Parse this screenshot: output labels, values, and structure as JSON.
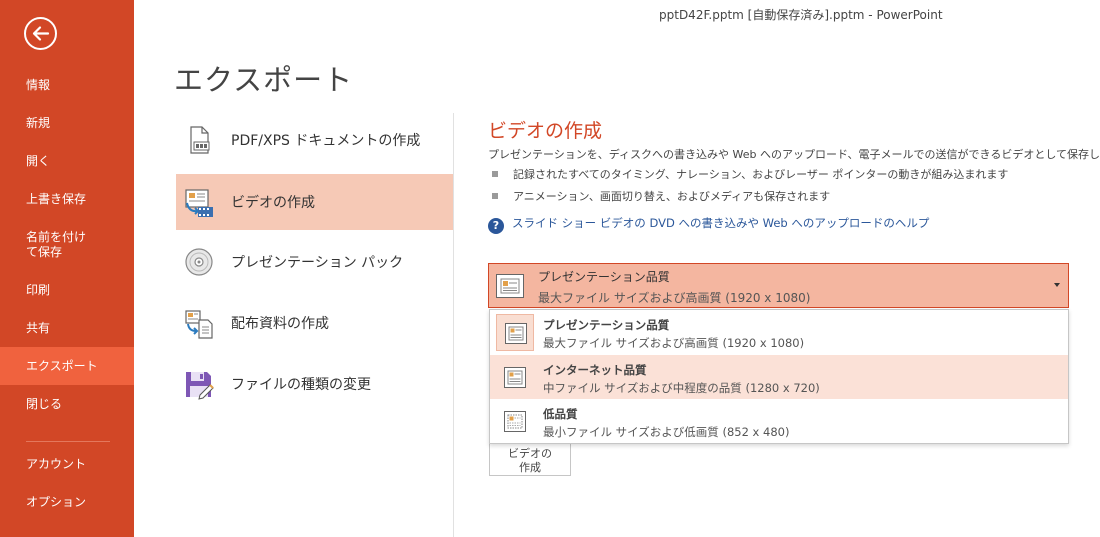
{
  "window": {
    "title": "pptD42F.pptm [自動保存済み].pptm - PowerPoint"
  },
  "sidebar": {
    "back_icon": "back-arrow-icon",
    "items": [
      {
        "label": "情報"
      },
      {
        "label": "新規"
      },
      {
        "label": "開く"
      },
      {
        "label": "上書き保存"
      },
      {
        "label": "名前を付けて保存"
      },
      {
        "label": "印刷"
      },
      {
        "label": "共有"
      },
      {
        "label": "エクスポート",
        "active": true
      },
      {
        "label": "閉じる"
      },
      {
        "label": "アカウント"
      },
      {
        "label": "オプション"
      }
    ]
  },
  "page": {
    "title": "エクスポート"
  },
  "export_options": [
    {
      "label": "PDF/XPS ドキュメントの作成",
      "icon": "pdf-document-icon"
    },
    {
      "label": "ビデオの作成",
      "icon": "video-icon",
      "selected": true
    },
    {
      "label": "プレゼンテーション パック",
      "icon": "cd-package-icon"
    },
    {
      "label": "配布資料の作成",
      "icon": "handout-icon"
    },
    {
      "label": "ファイルの種類の変更",
      "icon": "change-file-type-icon"
    }
  ],
  "video": {
    "title": "ビデオの作成",
    "description": "プレゼンテーションを、ディスクへの書き込みや Web へのアップロード、電子メールでの送信ができるビデオとして保存します。",
    "bullets": [
      "記録されたすべてのタイミング、ナレーション、およびレーザー ポインターの動きが組み込まれます",
      "アニメーション、画面切り替え、およびメディアも保存されます"
    ],
    "help_link": "スライド ショー ビデオの DVD への書き込みや Web へのアップロードのヘルプ",
    "quality_dropdown": {
      "selected_title": "プレゼンテーション品質",
      "selected_desc": "最大ファイル サイズおよび高画質 (1920 x 1080)",
      "options": [
        {
          "title": "プレゼンテーション品質",
          "desc": "最大ファイル サイズおよび高画質 (1920 x 1080)"
        },
        {
          "title": "インターネット品質",
          "desc": "中ファイル サイズおよび中程度の品質 (1280 x 720)"
        },
        {
          "title": "低品質",
          "desc": "最小ファイル サイズおよび低画質 (852 x 480)"
        }
      ]
    },
    "create_button": {
      "label_line1": "ビデオの",
      "label_line2": "作成"
    }
  },
  "colors": {
    "accent": "#d24726",
    "accent_light": "#f0623e",
    "selection": "#f6c9b6",
    "link": "#2b579a"
  }
}
